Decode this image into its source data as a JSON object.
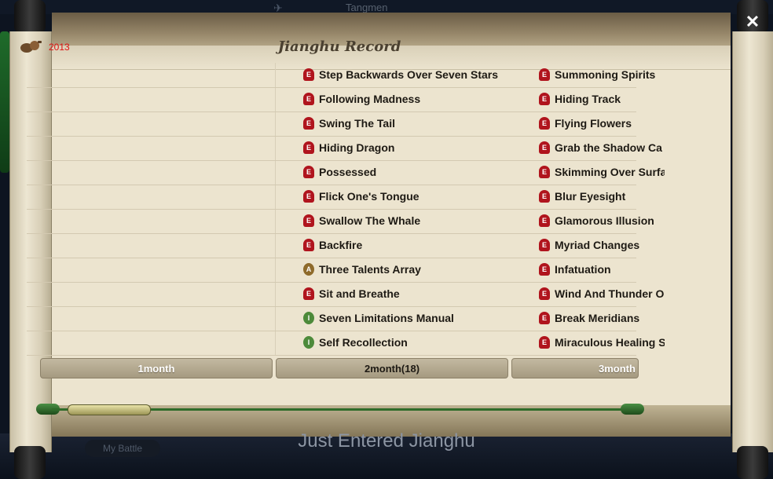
{
  "background": {
    "top_title": "Tangmen",
    "my_battle_label": "My Battle",
    "status_text": "Just Entered Jianghu"
  },
  "close_label": "✕",
  "record": {
    "year": "2013",
    "title": "Jianghu Record"
  },
  "columns": {
    "middle": [
      {
        "badge": "E",
        "name": "Step Backwards Over Seven Stars"
      },
      {
        "badge": "E",
        "name": "Following Madness"
      },
      {
        "badge": "E",
        "name": "Swing The Tail"
      },
      {
        "badge": "E",
        "name": "Hiding Dragon"
      },
      {
        "badge": "E",
        "name": "Possessed"
      },
      {
        "badge": "E",
        "name": "Flick One's Tongue"
      },
      {
        "badge": "E",
        "name": "Swallow The Whale"
      },
      {
        "badge": "E",
        "name": "Backfire"
      },
      {
        "badge": "A",
        "name": "Three Talents Array"
      },
      {
        "badge": "E",
        "name": "Sit and Breathe"
      },
      {
        "badge": "I",
        "name": "Seven Limitations Manual"
      },
      {
        "badge": "I",
        "name": "Self Recollection"
      }
    ],
    "right": [
      {
        "badge": "E",
        "name": "Summoning Spirits"
      },
      {
        "badge": "E",
        "name": "Hiding Track"
      },
      {
        "badge": "E",
        "name": "Flying Flowers"
      },
      {
        "badge": "E",
        "name": "Grab the Shadow Ca"
      },
      {
        "badge": "E",
        "name": "Skimming Over Surfa"
      },
      {
        "badge": "E",
        "name": "Blur Eyesight"
      },
      {
        "badge": "E",
        "name": "Glamorous Illusion"
      },
      {
        "badge": "E",
        "name": "Myriad Changes"
      },
      {
        "badge": "E",
        "name": "Infatuation"
      },
      {
        "badge": "E",
        "name": "Wind And Thunder O"
      },
      {
        "badge": "E",
        "name": "Break Meridians"
      },
      {
        "badge": "E",
        "name": "Miraculous Healing S"
      }
    ]
  },
  "tabs": [
    "1month",
    "2month(18)",
    "3month"
  ],
  "colors": {
    "badge_E": "#b0141d",
    "badge_A": "#8e6a2a",
    "badge_I": "#4d8a3a",
    "year": "#e01010"
  }
}
